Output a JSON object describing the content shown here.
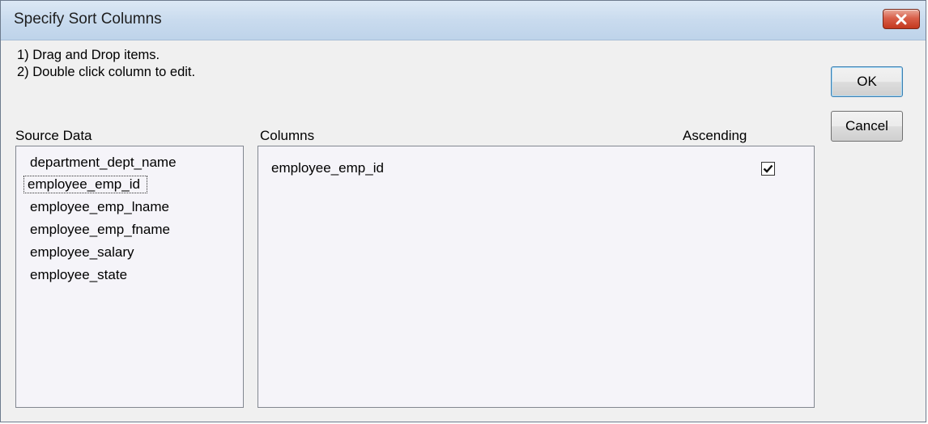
{
  "window": {
    "title": "Specify Sort Columns"
  },
  "instructions": [
    "1) Drag and Drop items.",
    "2) Double click column to edit."
  ],
  "source": {
    "label": "Source Data",
    "items": [
      "department_dept_name",
      "employee_emp_id",
      "employee_emp_lname",
      "employee_emp_fname",
      "employee_salary",
      "employee_state"
    ],
    "focused_index": 1
  },
  "columns": {
    "label": "Columns",
    "ascending_label": "Ascending",
    "rows": [
      {
        "name": "employee_emp_id",
        "ascending": true
      }
    ]
  },
  "buttons": {
    "ok_label": "OK",
    "cancel_label": "Cancel"
  },
  "icons": {
    "close": "close-icon",
    "check": "checkmark-icon"
  }
}
